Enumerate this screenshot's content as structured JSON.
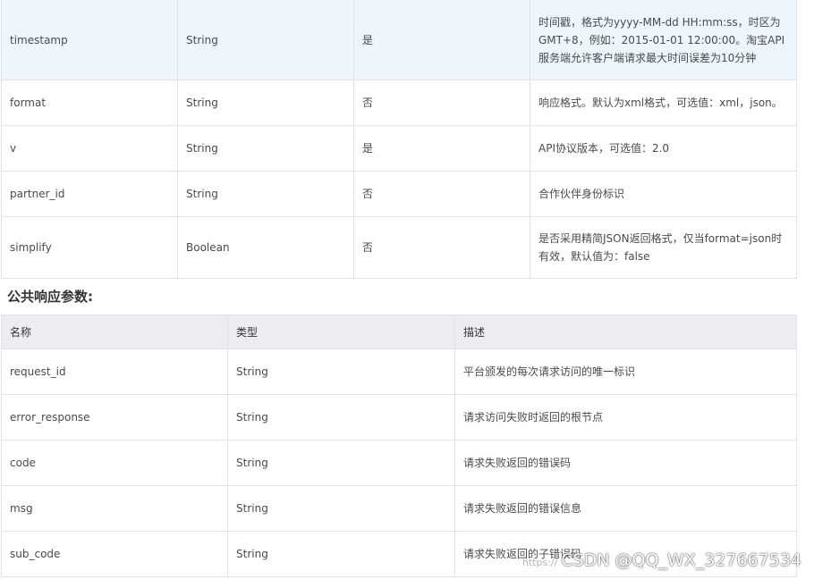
{
  "params_table": {
    "rows": [
      {
        "name": "timestamp",
        "type": "String",
        "required": "是",
        "desc": "时间戳，格式为yyyy-MM-dd HH:mm:ss，时区为GMT+8，例如：2015-01-01 12:00:00。淘宝API服务端允许客户端请求最大时间误差为10分钟"
      },
      {
        "name": "format",
        "type": "String",
        "required": "否",
        "desc": "响应格式。默认为xml格式，可选值：xml，json。"
      },
      {
        "name": "v",
        "type": "String",
        "required": "是",
        "desc": "API协议版本，可选值：2.0"
      },
      {
        "name": "partner_id",
        "type": "String",
        "required": "否",
        "desc": "合作伙伴身份标识"
      },
      {
        "name": "simplify",
        "type": "Boolean",
        "required": "否",
        "desc": "是否采用精简JSON返回格式，仅当format=json时有效，默认值为：false"
      }
    ]
  },
  "section_title": "公共响应参数:",
  "response_table": {
    "headers": {
      "name": "名称",
      "type": "类型",
      "desc": "描述"
    },
    "rows": [
      {
        "name": "request_id",
        "type": "String",
        "desc": "平台颁发的每次请求访问的唯一标识"
      },
      {
        "name": "error_response",
        "type": "String",
        "desc": "请求访问失败时返回的根节点"
      },
      {
        "name": "code",
        "type": "String",
        "desc": "请求失败返回的错误码"
      },
      {
        "name": "msg",
        "type": "String",
        "desc": "请求失败返回的错误信息"
      },
      {
        "name": "sub_code",
        "type": "String",
        "desc": "请求失败返回的子错误码"
      }
    ]
  },
  "watermark": {
    "faint": "https://",
    "text": "CSDN @QQ_WX_327667534"
  }
}
